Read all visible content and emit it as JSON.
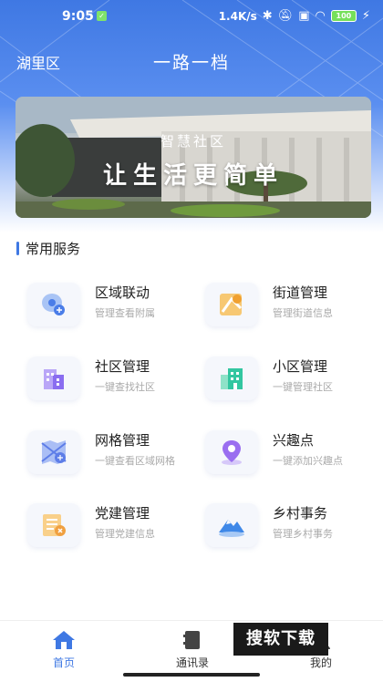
{
  "status_bar": {
    "time": "9:05",
    "speed": "1.4K/s",
    "battery": "100"
  },
  "header": {
    "district": "湖里区",
    "app_title": "一路一档"
  },
  "banner": {
    "subtitle": "智慧社区",
    "title": "让生活更简单"
  },
  "section": {
    "title": "常用服务"
  },
  "services": [
    {
      "name": "区域联动",
      "desc": "管理查看附属",
      "icon": "map-pin-chat-icon",
      "color": "#4a7de8"
    },
    {
      "name": "街道管理",
      "desc": "管理街道信息",
      "icon": "street-map-icon",
      "color": "#f0a030"
    },
    {
      "name": "社区管理",
      "desc": "一键查找社区",
      "icon": "building-icon",
      "color": "#8a6df0"
    },
    {
      "name": "小区管理",
      "desc": "一键管理社区",
      "icon": "residential-icon",
      "color": "#32c6a0"
    },
    {
      "name": "网格管理",
      "desc": "一键查看区域网格",
      "icon": "grid-map-icon",
      "color": "#5d7de8"
    },
    {
      "name": "兴趣点",
      "desc": "一键添加兴趣点",
      "icon": "location-pin-icon",
      "color": "#9a6ef0"
    },
    {
      "name": "党建管理",
      "desc": "管理党建信息",
      "icon": "party-doc-icon",
      "color": "#f0a040"
    },
    {
      "name": "乡村事务",
      "desc": "管理乡村事务",
      "icon": "mountain-icon",
      "color": "#3f88e8"
    }
  ],
  "tabs": [
    {
      "label": "首页",
      "icon": "home-icon"
    },
    {
      "label": "通讯录",
      "icon": "contacts-icon"
    },
    {
      "label": "我的",
      "icon": "user-icon"
    }
  ],
  "watermark": "搜软下载"
}
